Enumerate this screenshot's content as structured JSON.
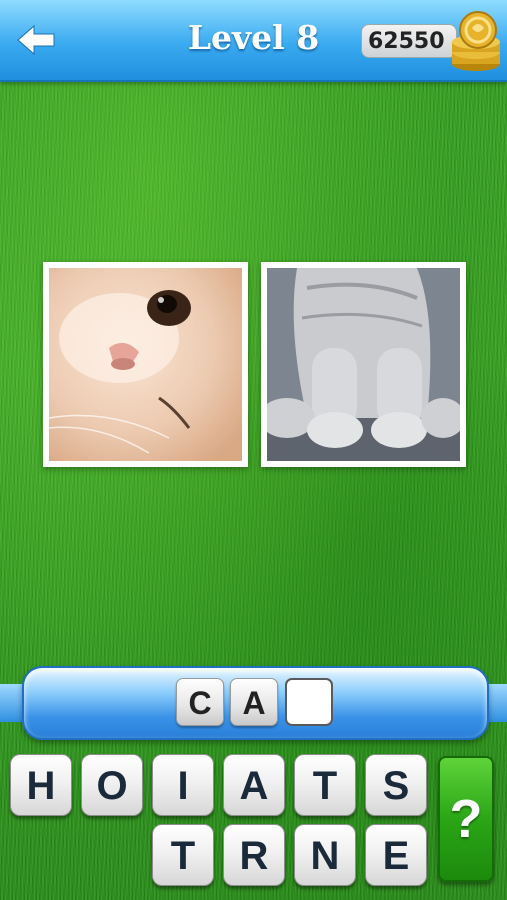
{
  "header": {
    "title": "Level 8",
    "coins": "62550",
    "back_icon": "back-arrow-icon",
    "coin_icon": "coin-stack-icon"
  },
  "pictures": [
    {
      "subject": "white cat face close-up"
    },
    {
      "subject": "grey kitten paws"
    }
  ],
  "answer": {
    "slots": [
      "C",
      "A",
      ""
    ]
  },
  "letters": {
    "row1": [
      "H",
      "O",
      "I",
      "A",
      "T",
      "S"
    ],
    "row2": [
      "T",
      "R",
      "N",
      "E"
    ]
  },
  "hint": {
    "label": "?"
  },
  "colors": {
    "header": "#3aaaf0",
    "grass": "#3aa922",
    "hint": "#2aa616"
  }
}
